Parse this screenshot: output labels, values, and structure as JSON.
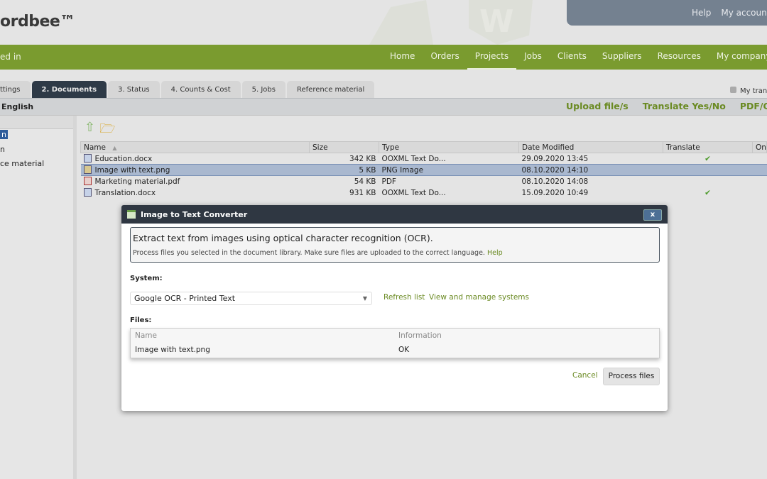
{
  "header": {
    "logo": "ordbee™",
    "top_links": [
      "Help",
      "My accoun"
    ]
  },
  "nav": {
    "logged_in": "ed in",
    "items": [
      "Home",
      "Orders",
      "Projects",
      "Jobs",
      "Clients",
      "Suppliers",
      "Resources",
      "My company"
    ],
    "active": "Projects"
  },
  "tabs": [
    "ttings",
    "2. Documents",
    "3. Status",
    "4. Counts & Cost",
    "5. Jobs",
    "Reference material"
  ],
  "my_trans": "My tran",
  "langbar": {
    "language": "English",
    "links": [
      "Upload file/s",
      "Translate Yes/No",
      "PDF/OCR"
    ]
  },
  "left_tree": [
    "n",
    "n",
    "ce material"
  ],
  "file_table": {
    "columns": [
      "Name",
      "Size",
      "Type",
      "Date Modified",
      "Translate",
      "On"
    ],
    "rows": [
      {
        "name": "Education.docx",
        "size": "342 KB",
        "type": "OOXML Text Do...",
        "date": "29.09.2020 13:45",
        "translate": "✔",
        "icon": "word"
      },
      {
        "name": "Image with text.png",
        "size": "5 KB",
        "type": "PNG Image",
        "date": "08.10.2020 14:10",
        "translate": "",
        "icon": "png",
        "selected": true
      },
      {
        "name": "Marketing material.pdf",
        "size": "54 KB",
        "type": "PDF",
        "date": "08.10.2020 14:08",
        "translate": "",
        "icon": "pdf"
      },
      {
        "name": "Translation.docx",
        "size": "931 KB",
        "type": "OOXML Text Do...",
        "date": "15.09.2020 10:49",
        "translate": "✔",
        "icon": "word"
      }
    ]
  },
  "dialog": {
    "title": "Image to Text Converter",
    "close": "x",
    "heading": "Extract text from images using optical character recognition (OCR).",
    "subtext": "Process files you selected in the document library. Make sure files are uploaded to the correct language.",
    "help": "Help",
    "system_label": "System:",
    "system_value": "Google OCR - Printed Text",
    "refresh": "Refresh list",
    "manage": "View and manage systems",
    "files_label": "Files:",
    "files_columns": [
      "Name",
      "Information"
    ],
    "files_rows": [
      {
        "name": "Image with text.png",
        "info": "OK"
      }
    ],
    "cancel": "Cancel",
    "process": "Process files"
  },
  "colors": {
    "nav_green": "#7a9b2f",
    "dark_tab": "#2e3a47",
    "link_green": "#6a8a22",
    "selection": "#a9b8cf"
  }
}
